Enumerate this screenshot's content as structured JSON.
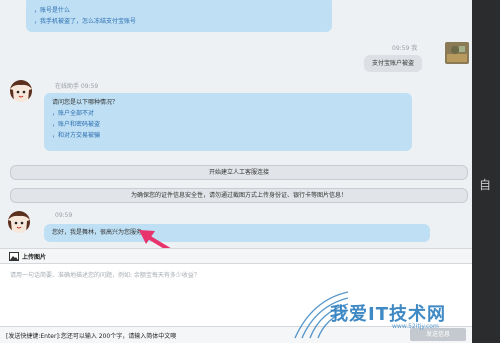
{
  "conversation": {
    "first_bubble_links": [
      "，账号是什么",
      "，我手机被盗了，怎么冻结支付宝账号"
    ],
    "user_message": {
      "time": "09:59 我",
      "text": "支付宝账户被盗"
    },
    "assistant_message": {
      "sender_time": "在线助手 09:59",
      "question": "请问您是以下哪种情况？",
      "options": [
        "，账户全部不对",
        "，账户和密码被盗",
        "，和对方交易被骗"
      ]
    },
    "system_notices": [
      "开始建立人工客服连接",
      "为确保您的证件信息安全性，请勿通过截图方式上传身份证、银行卡等图片信息！"
    ],
    "agent_message": {
      "time": "09:59",
      "text": "您好，我是舞林，很高兴为您服务。"
    }
  },
  "upload": {
    "label": "上传图片"
  },
  "input": {
    "placeholder": "请用一句话简要、准确地描述您的问题，例如: 余额宝每天有多少收益？"
  },
  "footer": {
    "hint": "[发送快捷键:Enter]:您还可以输入 200个字，请输入简体中文噢",
    "send_label": "发送信息"
  },
  "side": {
    "glyph": "自"
  },
  "watermark": {
    "text": "我爱IT技术网",
    "url": "www.52itjy.com"
  },
  "colors": {
    "agent_bubble": "#bfe0f4",
    "user_bubble": "#dcdfe3",
    "annotation_arrow": "#e8336d",
    "watermark": "#2f7fbf"
  },
  "icons": {
    "upload": "image-icon",
    "annotation": "pointer-arrow-icon"
  }
}
